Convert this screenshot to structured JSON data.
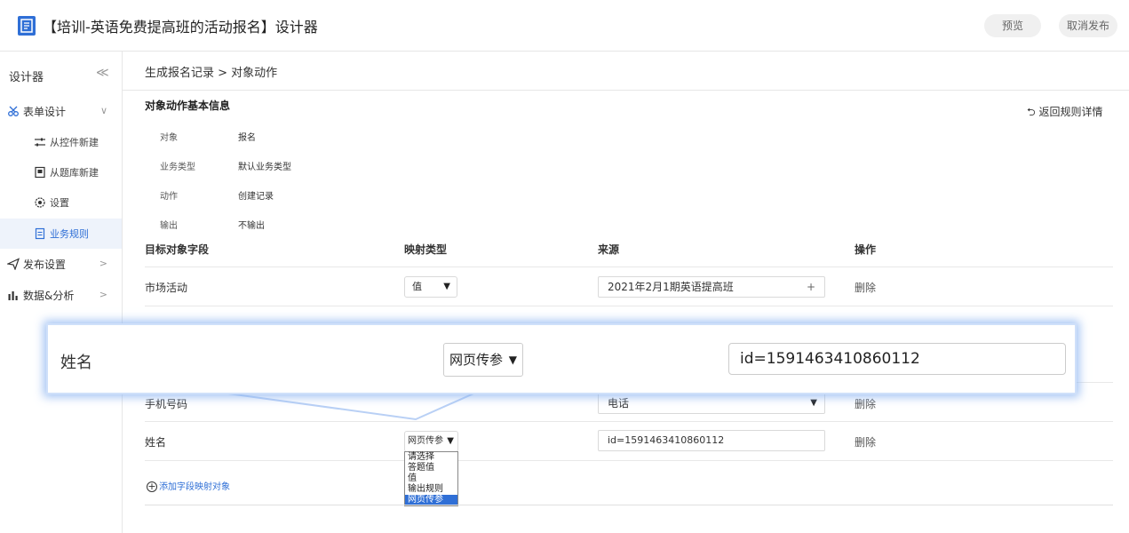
{
  "header": {
    "title": "【培训-英语免费提高班的活动报名】设计器",
    "preview_label": "预览",
    "unpublish_label": "取消发布"
  },
  "sidebar": {
    "heading": "设计器",
    "collapse_glyph": "≪",
    "items": [
      {
        "label": "表单设计",
        "icon": "scissors-icon",
        "level": 1,
        "chevron": "∨"
      },
      {
        "label": "从控件新建",
        "icon": "sliders-icon",
        "level": 2
      },
      {
        "label": "从题库新建",
        "icon": "bank-icon",
        "level": 2
      },
      {
        "label": "设置",
        "icon": "gear-icon",
        "level": 2
      },
      {
        "label": "业务规则",
        "icon": "doc-icon",
        "level": 2,
        "active": true
      },
      {
        "label": "发布设置",
        "icon": "send-icon",
        "level": 1,
        "chevron": ">"
      },
      {
        "label": "数据&分析",
        "icon": "chart-icon",
        "level": 1,
        "chevron": ">"
      }
    ]
  },
  "breadcrumb": "生成报名记录 > 对象动作",
  "basic_info": {
    "title": "对象动作基本信息",
    "back_label": "返回规则详情",
    "rows": [
      {
        "label": "对象",
        "value": "报名"
      },
      {
        "label": "业务类型",
        "value": "默认业务类型"
      },
      {
        "label": "动作",
        "value": "创建记录"
      },
      {
        "label": "输出",
        "value": "不输出"
      }
    ]
  },
  "table": {
    "headers": [
      "目标对象字段",
      "映射类型",
      "来源",
      "操作"
    ],
    "rows": [
      {
        "field": "市场活动",
        "map_type": "值",
        "source": "2021年2月1期英语提高班",
        "action": "删除"
      },
      {
        "field": "手机号码",
        "map_type": "",
        "source": "电话",
        "action": "删除"
      },
      {
        "field": "姓名",
        "map_type": "网页传参",
        "source": "id=1591463410860112",
        "action": "删除"
      }
    ],
    "add_label": "添加字段映射对象"
  },
  "dropdown": {
    "options": [
      "请选择",
      "答题值",
      "值",
      "输出规则",
      "网页传参"
    ],
    "selected": "网页传参"
  },
  "callout": {
    "field": "姓名",
    "map_type": "网页传参",
    "source": "id=1591463410860112"
  },
  "colors": {
    "accent": "#2f6fd6",
    "callout_glow": "#8cb4f0"
  }
}
